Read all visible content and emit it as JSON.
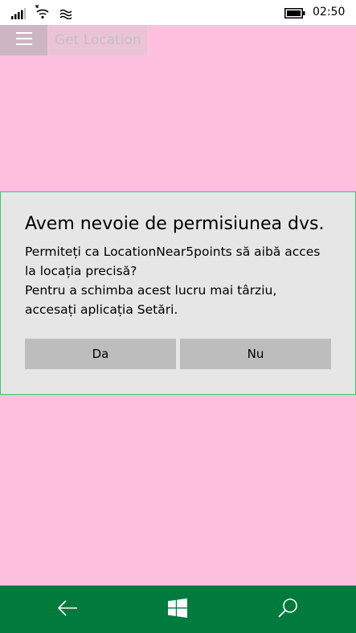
{
  "status_bar": {
    "time": "02:50",
    "icons": [
      "signal-icon",
      "wifi-icon",
      "wifi-calling-icon",
      "battery-icon"
    ]
  },
  "app_bar": {
    "menu_icon": "hamburger-icon",
    "title": "Get Location"
  },
  "dialog": {
    "title": "Avem nevoie de permisiunea dvs.",
    "message_lines": [
      "Permiteți ca LocationNear5points să aibă acces",
      "la locația precisă?",
      "Pentru a schimba acest lucru mai târziu,",
      "accesați aplicația Setări."
    ],
    "buttons": {
      "yes": "Da",
      "no": "Nu"
    }
  },
  "nav_bar": {
    "icons": [
      "back-arrow-icon",
      "windows-start-icon",
      "search-icon"
    ]
  },
  "colors": {
    "page_background": "#fec0df",
    "dialog_background": "#e6e6e6",
    "dialog_border": "#3fbf73",
    "button_background": "#bdbdbd",
    "nav_bar_background": "#007a3d"
  }
}
